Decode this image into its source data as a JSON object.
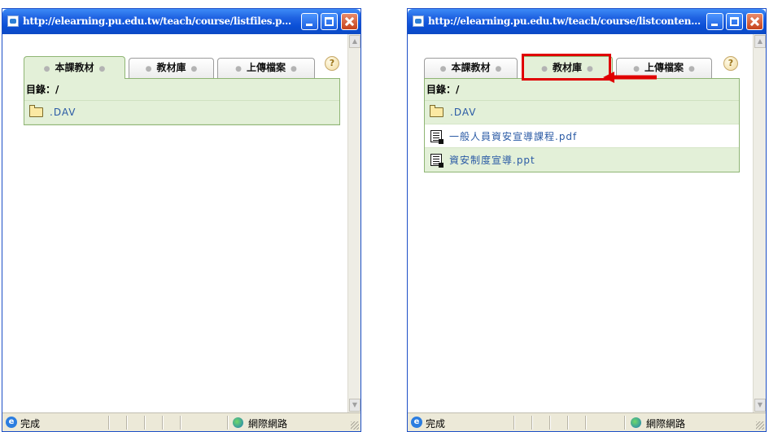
{
  "windows": [
    {
      "title": "http://elearning.pu.edu.tw/teach/course/listfiles.p...",
      "tabs": [
        {
          "label": "本課教材"
        },
        {
          "label": "教材庫"
        },
        {
          "label": "上傳檔案"
        }
      ],
      "active_tab": "本課教材",
      "directory_label": "目錄：/",
      "files": [
        {
          "name": ".DAV",
          "type": "folder"
        }
      ],
      "status_text": "完成",
      "zone_text": "網際網路"
    },
    {
      "title": "http://elearning.pu.edu.tw/teach/course/listconten...",
      "tabs": [
        {
          "label": "本課教材"
        },
        {
          "label": "教材庫"
        },
        {
          "label": "上傳檔案"
        }
      ],
      "active_tab": "教材庫",
      "highlighted_tab": "教材庫",
      "directory_label": "目錄：/",
      "files": [
        {
          "name": ".DAV",
          "type": "folder"
        },
        {
          "name": "一般人員資安宣導課程.pdf",
          "type": "document"
        },
        {
          "name": "資安制度宣導.ppt",
          "type": "document"
        }
      ],
      "status_text": "完成",
      "zone_text": "網際網路"
    }
  ],
  "help_icon": "question-mark-icon",
  "colors": {
    "titlebar": "#0a4fd6",
    "tab_active_bg": "#e3f0d8",
    "panel_border": "#8fb574",
    "link_text": "#2a5aa5",
    "annotation_red": "#e00000"
  }
}
